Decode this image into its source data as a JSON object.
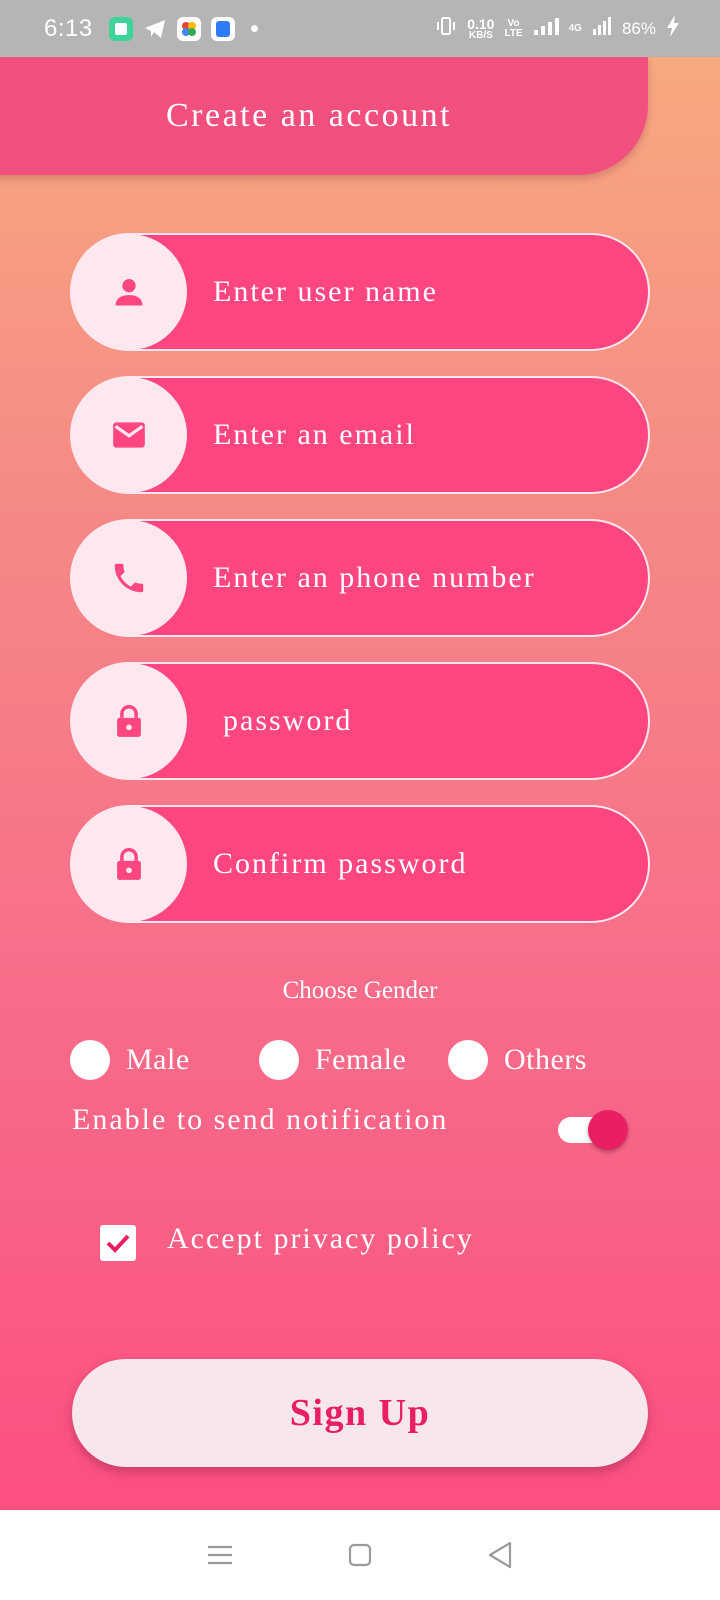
{
  "status_bar": {
    "time": "6:13",
    "net_speed_value": "0.10",
    "net_speed_unit": "KB/S",
    "volte_top": "Vo",
    "volte_bottom": "LTE",
    "network": "4G",
    "battery": "86%"
  },
  "header": {
    "title": "Create an account"
  },
  "fields": [
    {
      "placeholder": "Enter user name",
      "icon": "person-icon"
    },
    {
      "placeholder": "Enter an email",
      "icon": "email-icon"
    },
    {
      "placeholder": "Enter an phone number",
      "icon": "phone-icon"
    },
    {
      "placeholder": "password",
      "icon": "lock-icon"
    },
    {
      "placeholder": "Confirm password",
      "icon": "lock-icon"
    }
  ],
  "gender": {
    "label": "Choose Gender",
    "options": [
      "Male",
      "Female",
      "Others"
    ]
  },
  "notification": {
    "label": "Enable to send notification",
    "enabled": true
  },
  "privacy": {
    "label": "Accept privacy policy",
    "checked": true
  },
  "signup": {
    "label": "Sign Up"
  },
  "colors": {
    "accent": "#e91e63",
    "field_bg": "#ff4681",
    "icon_circle_bg": "#fde8ef",
    "header_bg": "#f1507e"
  }
}
